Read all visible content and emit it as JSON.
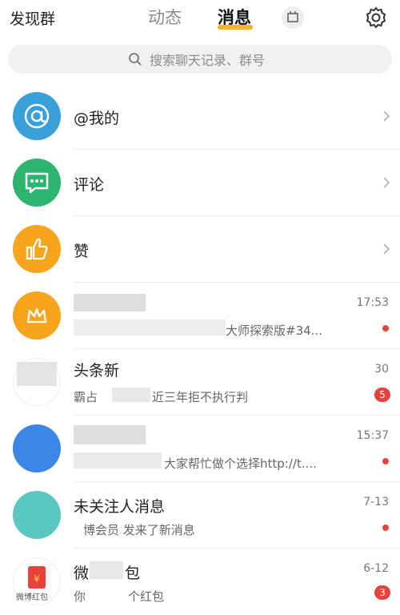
{
  "header": {
    "left_label": "发现群",
    "tabs": [
      {
        "label": "动态",
        "active": false
      },
      {
        "label": "消息",
        "active": true
      }
    ],
    "accent_color": "#f5b428",
    "icons": [
      "inbox-icon",
      "gear-icon"
    ]
  },
  "search": {
    "placeholder": "搜索聊天记录、群号"
  },
  "system_items": [
    {
      "title": "@我的",
      "icon": "at-icon",
      "color": "#3aa0da"
    },
    {
      "title": "评论",
      "icon": "comment-icon",
      "color": "#2db56f"
    },
    {
      "title": "赞",
      "icon": "thumbs-up-icon",
      "color": "#f7a51a"
    }
  ],
  "conversations": [
    {
      "title": "",
      "subtitle": "大师探索版#34...",
      "time": "17:53",
      "badge": ""
    },
    {
      "title": "头条新",
      "subtitle": "霸占",
      "time": "30",
      "badge": "5",
      "extra_text": "近三年拒不执行判"
    },
    {
      "title": "",
      "subtitle": "大家帮忙做个选择http://t....",
      "time": "15:37",
      "badge": ""
    },
    {
      "title": "未关注人消息",
      "subtitle": "博会员 发来了新消息",
      "time": "7-13",
      "badge": ""
    },
    {
      "title": "微",
      "subtitle": "你",
      "time": "6-12",
      "badge": "3",
      "title_end": "包",
      "extra_text": "个红包",
      "icon_label": "微博红包"
    }
  ],
  "status_colors": {
    "badge": "#e8423d"
  }
}
